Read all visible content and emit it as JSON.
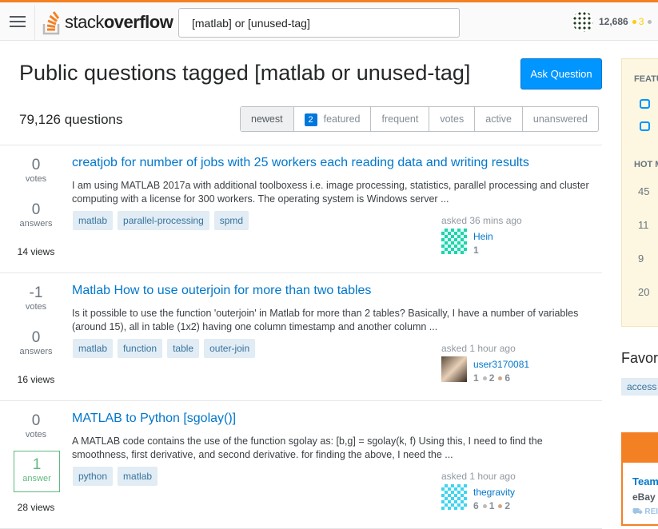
{
  "header": {
    "logo_text_light": "stack",
    "logo_text_bold": "overflow",
    "search_value": "[matlab] or [unused-tag]",
    "reputation": "12,686",
    "gold": "3"
  },
  "page": {
    "title": "Public questions tagged [matlab or unused-tag]",
    "ask_label": "Ask Question",
    "count": "79,126 questions"
  },
  "tabs": [
    {
      "label": "newest"
    },
    {
      "label": "featured",
      "badge": "2"
    },
    {
      "label": "frequent"
    },
    {
      "label": "votes"
    },
    {
      "label": "active"
    },
    {
      "label": "unanswered"
    }
  ],
  "questions": [
    {
      "votes": "0",
      "votes_label": "votes",
      "answers": "0",
      "answers_label": "answers",
      "views": "14 views",
      "title": "creatjob for number of jobs with 25 workers each reading data and writing results",
      "excerpt": "I am using MATLAB 2017a with additional toolboxess i.e. image processing, statistics, parallel processing and cluster computing with a license for 300 workers. The operating system is Windows server ...",
      "tags": [
        "matlab",
        "parallel-processing",
        "spmd"
      ],
      "asked": "asked 36 mins ago",
      "user": "Hein",
      "rep": "1"
    },
    {
      "votes": "-1",
      "votes_label": "votes",
      "answers": "0",
      "answers_label": "answers",
      "views": "16 views",
      "title": "Matlab How to use outerjoin for more than two tables",
      "excerpt": "Is it possible to use the function 'outerjoin' in Matlab for more than 2 tables? Basically, I have a number of variables (around 15), all in table (1x2) having one column timestamp and another column ...",
      "tags": [
        "matlab",
        "function",
        "table",
        "outer-join"
      ],
      "asked": "asked 1 hour ago",
      "user": "user3170081",
      "rep": "1",
      "silver": "2",
      "bronze": "6"
    },
    {
      "votes": "0",
      "votes_label": "votes",
      "answers": "1",
      "answers_label": "answer",
      "views": "28 views",
      "title": "MATLAB to Python [sgolay()]",
      "excerpt": "A MATLAB code contains the use of the function sgolay as: [b,g] = sgolay(k, f) Using this, I need to find the smoothness, first derivative, and second derivative. for finding the above, I need the ...",
      "tags": [
        "python",
        "matlab"
      ],
      "asked": "asked 1 hour ago",
      "user": "thegravity",
      "rep": "6",
      "silver": "1",
      "bronze": "2"
    }
  ],
  "sidebar": {
    "featured_heading": "FEATU",
    "hot_heading": "HOT M",
    "hot_counts": [
      "45",
      "11",
      "9",
      "20"
    ],
    "favorites_heading": "Favor",
    "favorite_tag": "access",
    "job_title": "Team",
    "job_company": "eBay",
    "job_remote": "REI"
  }
}
